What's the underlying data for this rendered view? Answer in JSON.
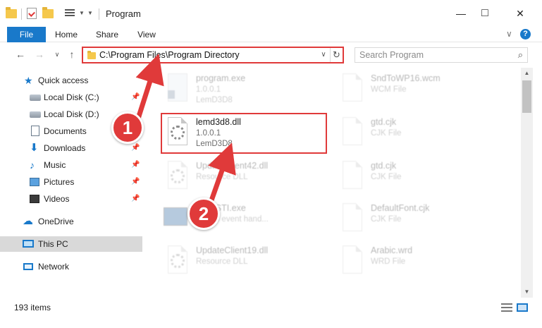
{
  "window": {
    "title": "Program",
    "minimize": "—",
    "maximize": "□",
    "close": "✕"
  },
  "ribbon": {
    "tabs": [
      "File",
      "Home",
      "Share",
      "View"
    ],
    "expand": "∨",
    "help": "?"
  },
  "nav": {
    "back": "←",
    "forward": "→",
    "recent": "∨",
    "up": "↑",
    "address": "C:\\Program Files\\Program Directory",
    "address_dropdown": "∨",
    "refresh": "↻",
    "search_placeholder": "Search Program",
    "search_icon": "⌕"
  },
  "sidebar": {
    "items": [
      {
        "label": "Quick access",
        "icon": "star-icon",
        "pinned": false
      },
      {
        "label": "Local Disk (C:)",
        "icon": "drive-icon",
        "pinned": true
      },
      {
        "label": "Local Disk (D:)",
        "icon": "drive-icon",
        "pinned": false
      },
      {
        "label": "Documents",
        "icon": "documents-icon",
        "pinned": true
      },
      {
        "label": "Downloads",
        "icon": "downloads-icon",
        "pinned": true
      },
      {
        "label": "Music",
        "icon": "music-icon",
        "pinned": true
      },
      {
        "label": "Pictures",
        "icon": "pictures-icon",
        "pinned": true
      },
      {
        "label": "Videos",
        "icon": "videos-icon",
        "pinned": true
      },
      {
        "label": "OneDrive",
        "icon": "cloud-icon",
        "pinned": false
      },
      {
        "label": "This PC",
        "icon": "computer-icon",
        "pinned": false,
        "selected": true
      },
      {
        "label": "Network",
        "icon": "network-icon",
        "pinned": false
      }
    ]
  },
  "files": {
    "left": [
      {
        "name": "program.exe",
        "line1": "1.0.0.1",
        "line2": "LemD3D8",
        "faded": true
      },
      {
        "name": "lemd3d8.dll",
        "line1": "1.0.0.1",
        "line2": "LemD3D8",
        "faded": false,
        "highlighted": true
      },
      {
        "name": "UpdateClient42.dll",
        "line1": "Resource DLL",
        "line2": "",
        "faded": true
      },
      {
        "name": "EasySTI.exe",
        "line1": "STI sb event hand...",
        "line2": "",
        "faded": true
      },
      {
        "name": "UpdateClient19.dll",
        "line1": "Resource DLL",
        "line2": "",
        "faded": true
      }
    ],
    "right": [
      {
        "name": "SndToWP16.wcm",
        "line1": "WCM File",
        "faded": true
      },
      {
        "name": "gtd.cjk",
        "line1": "CJK File",
        "faded": true
      },
      {
        "name": "gtd.cjk",
        "line1": "CJK File",
        "faded": true
      },
      {
        "name": "DefaultFont.cjk",
        "line1": "CJK File",
        "faded": true
      },
      {
        "name": "Arabic.wrd",
        "line1": "WRD File",
        "faded": true
      }
    ]
  },
  "status": {
    "item_count": "193 items"
  },
  "annotations": {
    "step1": "1",
    "step2": "2",
    "accent_color": "#e03a3a"
  },
  "colors": {
    "brand_blue": "#1979ca",
    "selection": "#d9d9d9"
  }
}
